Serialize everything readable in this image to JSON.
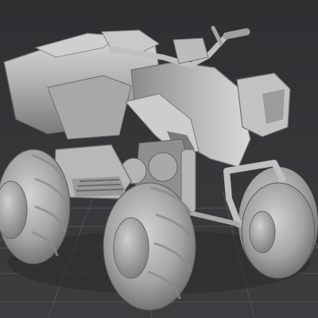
{
  "viewport": {
    "subject": "atv-quad-bike-model",
    "colors": {
      "background": "#323235",
      "grid": "#555558",
      "model_light": "#d0d0d0",
      "model_mid": "#a6a6a6",
      "model_dark": "#6e6e6e",
      "shadow": "#2a2a2a"
    }
  }
}
